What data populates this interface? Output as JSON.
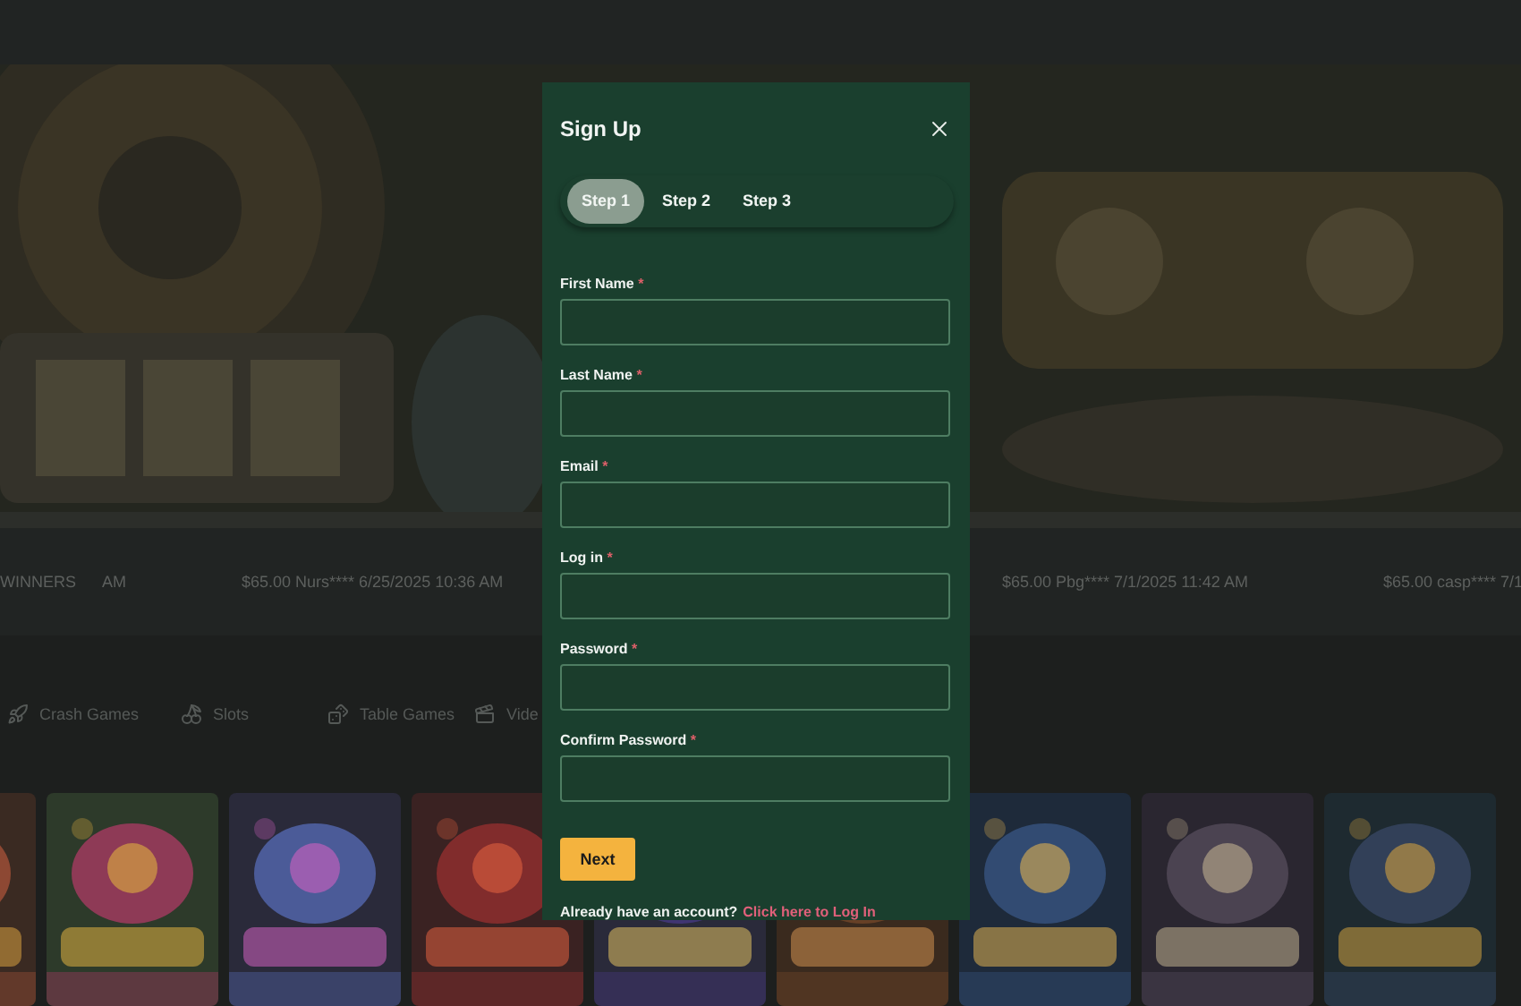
{
  "ticker": [
    {
      "text": "WINNERS"
    },
    {
      "text": "AM"
    },
    {
      "text": "$65.00 Nurs**** 6/25/2025 10:36 AM"
    },
    {
      "text": "$65.00 Pbg**** 7/1/2025 11:42 AM"
    },
    {
      "text": "$65.00 casp**** 7/1"
    }
  ],
  "categories": [
    {
      "label": "Crash Games",
      "kind": "crash"
    },
    {
      "label": "Slots",
      "kind": "slots"
    },
    {
      "label": "Table Games",
      "kind": "table"
    },
    {
      "label": "Vide",
      "kind": "video"
    }
  ],
  "modal": {
    "title": "Sign Up",
    "steps": [
      {
        "label": "Step 1",
        "selected": true
      },
      {
        "label": "Step 2",
        "selected": false
      },
      {
        "label": "Step 3",
        "selected": false
      }
    ],
    "fields": [
      {
        "label": "First Name",
        "mark": "*"
      },
      {
        "label": "Last Name",
        "mark": "*"
      },
      {
        "label": "Email",
        "mark": "*"
      },
      {
        "label": "Log in",
        "mark": "*"
      },
      {
        "label": "Password",
        "mark": "*"
      },
      {
        "label": "Confirm Password",
        "mark": "*"
      }
    ],
    "next": "Next",
    "footer": "Already have an account?",
    "login_link": "Click here to Log In"
  }
}
